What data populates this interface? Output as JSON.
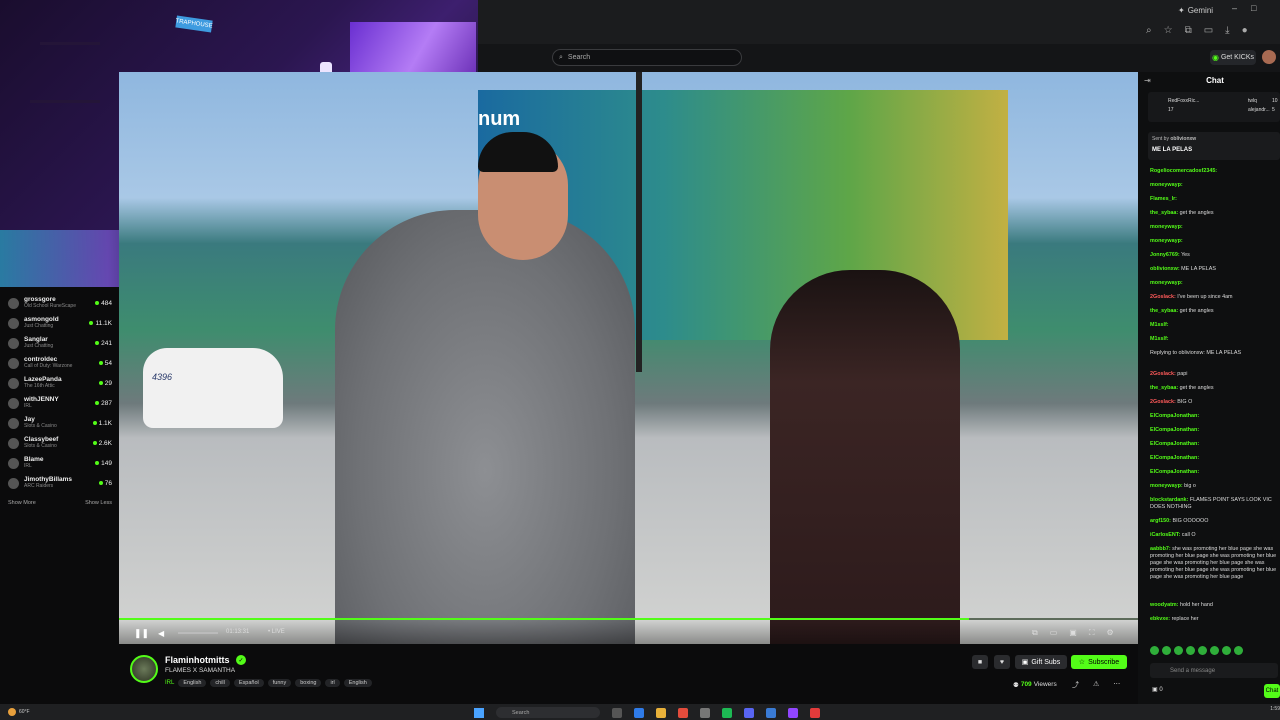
{
  "browser": {
    "gemini_label": "Gemini",
    "window_controls": [
      "–",
      "□"
    ]
  },
  "header": {
    "search_placeholder": "Search",
    "get_kicks_label": "Get KICKs"
  },
  "webcam": {
    "sign_text": "TRAPHOUSE"
  },
  "sidebar": {
    "items": [
      {
        "name": "grossgore",
        "category": "Old School RuneScape",
        "viewers": "484"
      },
      {
        "name": "asmongold",
        "category": "Just Chatting",
        "viewers": "11.1K"
      },
      {
        "name": "Sanglar",
        "category": "Just Chatting",
        "viewers": "241"
      },
      {
        "name": "controldec",
        "category": "Call of Duty: Warzone",
        "viewers": "54"
      },
      {
        "name": "LazeePanda",
        "category": "The 16th Attic",
        "viewers": "29"
      },
      {
        "name": "withJENNY",
        "category": "IRL",
        "viewers": "287"
      },
      {
        "name": "Jay",
        "category": "Slots & Casino",
        "viewers": "1.1K"
      },
      {
        "name": "Classybeef",
        "category": "Slots & Casino",
        "viewers": "2.6K"
      },
      {
        "name": "Blame",
        "category": "IRL",
        "viewers": "149"
      },
      {
        "name": "JimothyBillams",
        "category": "ARC Raiders",
        "viewers": "76"
      }
    ],
    "show_more": "Show More",
    "show_less": "Show Less"
  },
  "video": {
    "sign_text": "num",
    "car_number": "4396",
    "timestamp": "01:13:31",
    "live_label": "• LIVE",
    "progress_fraction": 0.834
  },
  "chat": {
    "title": "Chat",
    "gift_entries": [
      {
        "user": "RedFoxxRic...",
        "amount": "17"
      },
      {
        "user": "twlq",
        "amount": "10"
      },
      {
        "user": "alejandr...",
        "amount": "5"
      }
    ],
    "pinned_sent_by": "Sent by",
    "pinned_user": "oblivionxw",
    "pinned_message": "ME LA PELAS",
    "messages": [
      {
        "user": "Rogeliocomercadosf2345:",
        "text": "",
        "color": "#53fc18"
      },
      {
        "user": "moneywayp:",
        "text": "",
        "color": "#53fc18"
      },
      {
        "user": "Flames_Ir:",
        "text": "",
        "color": "#53fc18"
      },
      {
        "user": "the_sybaa:",
        "text": "get the angles",
        "color": "#53fc18"
      },
      {
        "user": "moneywayp:",
        "text": "",
        "color": "#53fc18"
      },
      {
        "user": "moneywayp:",
        "text": "",
        "color": "#53fc18"
      },
      {
        "user": "Jonny6769:",
        "text": "Yes",
        "color": "#53fc18"
      },
      {
        "user": "oblivionxw:",
        "text": "ME LA PELAS",
        "color": "#53fc18"
      },
      {
        "user": "moneywayp:",
        "text": "",
        "color": "#53fc18"
      },
      {
        "user": "2Goslack:",
        "text": "I've been up since 4am",
        "color": "#ff5a5a"
      },
      {
        "user": "the_sybaa:",
        "text": "get the angles",
        "color": "#53fc18"
      },
      {
        "user": "M1sslf:",
        "text": "",
        "color": "#53fc18"
      },
      {
        "user": "M1sslf:",
        "text": "",
        "color": "#53fc18"
      },
      {
        "user": "",
        "text": "Replying to oblivionxw: ME LA PELAS",
        "color": "#888"
      },
      {
        "user": "2Goslack:",
        "text": "papi",
        "color": "#ff5a5a"
      },
      {
        "user": "the_sybaa:",
        "text": "get the angles",
        "color": "#53fc18"
      },
      {
        "user": "2Goslack:",
        "text": "BIG O",
        "color": "#ff5a5a"
      },
      {
        "user": "ElCompaJonathan:",
        "text": "",
        "color": "#53fc18"
      },
      {
        "user": "ElCompaJonathan:",
        "text": "",
        "color": "#53fc18"
      },
      {
        "user": "ElCompaJonathan:",
        "text": "",
        "color": "#53fc18"
      },
      {
        "user": "ElCompaJonathan:",
        "text": "",
        "color": "#53fc18"
      },
      {
        "user": "ElCompaJonathan:",
        "text": "",
        "color": "#53fc18"
      },
      {
        "user": "moneywayp:",
        "text": "big o",
        "color": "#53fc18"
      },
      {
        "user": "blockstardank:",
        "text": "FLAMES POINT SAYS LOOK VIC DOES NOTHING",
        "color": "#53fc18"
      },
      {
        "user": "argf150:",
        "text": "BIG OOOOOO",
        "color": "#53fc18"
      },
      {
        "user": "iCarlosENT:",
        "text": "call O",
        "color": "#53fc18"
      },
      {
        "user": "aabbb7:",
        "text": "she was promoting her blue page she was promoting her blue page she was promoting her blue page she was promoting her blue page she was promoting her blue page she was promoting her blue page she was promoting her blue page",
        "color": "#53fc18"
      },
      {
        "user": "woodyatm:",
        "text": "hold her hand",
        "color": "#53fc18"
      },
      {
        "user": "ebkvxe:",
        "text": "replace her",
        "color": "#53fc18"
      }
    ],
    "input_placeholder": "Send a message",
    "send_label": "Chat",
    "count": "0"
  },
  "stream": {
    "streamer": "Flaminhotmitts",
    "title": "FLAMES X SAMANTHA",
    "category": "IRL",
    "tags": [
      "English",
      "chill",
      "Español",
      "funny",
      "boxing",
      "irl",
      "English"
    ],
    "gift_label": "Gift Subs",
    "subscribe_label": "Subscribe",
    "viewers_count": "709",
    "viewers_label": "Viewers"
  },
  "taskbar": {
    "weather": "60°F",
    "search_placeholder": "Search",
    "time": "1:59"
  },
  "colors": {
    "accent": "#53fc18",
    "background": "#0b0b0c"
  }
}
